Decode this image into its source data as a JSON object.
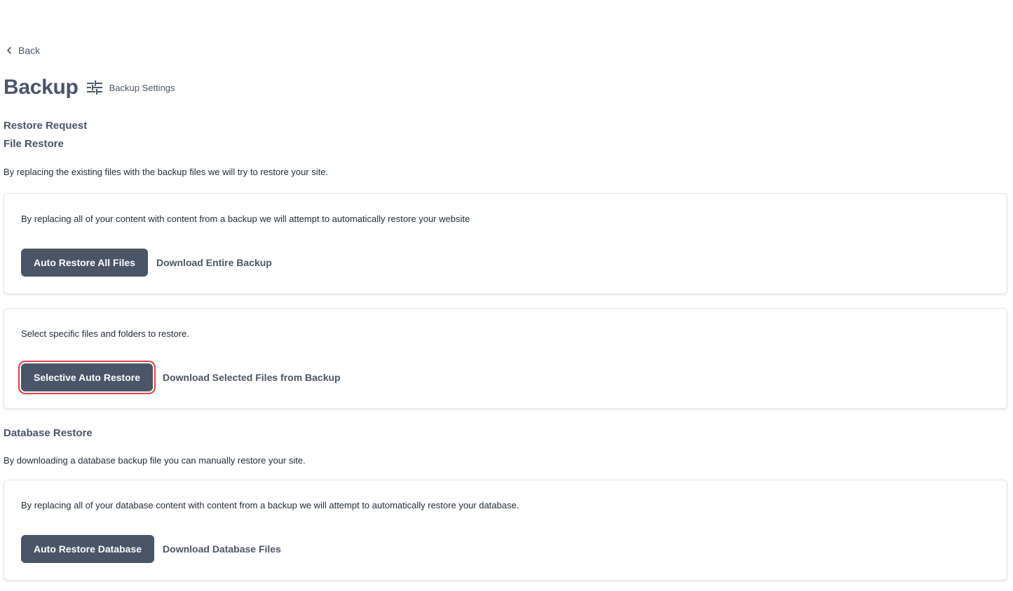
{
  "nav": {
    "back_label": "Back"
  },
  "header": {
    "title": "Backup",
    "settings_label": "Backup Settings"
  },
  "restore_request": {
    "heading": "Restore Request"
  },
  "file_restore": {
    "heading": "File Restore",
    "description": "By replacing the existing files with the backup files we will try to restore your site.",
    "cards": [
      {
        "text": "By replacing all of your content with content from a backup we will attempt to automatically restore your website",
        "primary_label": "Auto Restore All Files",
        "secondary_label": "Download Entire Backup"
      },
      {
        "text": "Select specific files and folders to restore.",
        "primary_label": "Selective Auto Restore",
        "secondary_label": "Download Selected Files from Backup"
      }
    ]
  },
  "database_restore": {
    "heading": "Database Restore",
    "description": "By downloading a database backup file you can manually restore your site.",
    "card": {
      "text": "By replacing all of your database content with content from a backup we will attempt to automatically restore your database.",
      "primary_label": "Auto Restore Database",
      "secondary_label": "Download Database Files"
    }
  },
  "colors": {
    "primary": "#4a5568",
    "highlight": "#e53e3e"
  }
}
